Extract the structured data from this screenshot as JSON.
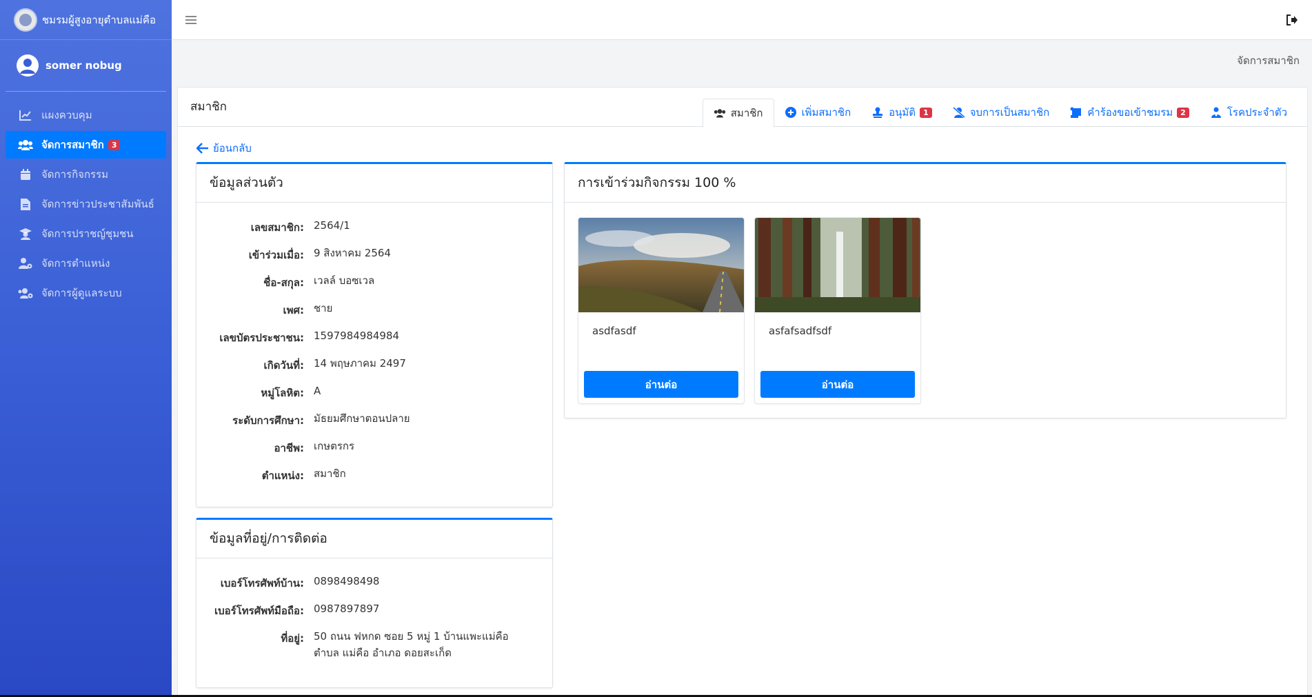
{
  "brand": {
    "title": "ชมรมผู้สูงอายุตำบลแม่คือ"
  },
  "user": {
    "name": "somer nobug"
  },
  "sidebar": {
    "items": [
      {
        "label": "แผงควบคุม",
        "icon": "chart-line-icon"
      },
      {
        "label": "จัดการสมาชิก",
        "icon": "users-icon",
        "badge": "3",
        "active": true
      },
      {
        "label": "จัดการกิจกรรม",
        "icon": "calendar-icon"
      },
      {
        "label": "จัดการข่าวประชาสัมพันธ์",
        "icon": "file-icon"
      },
      {
        "label": "จัดการปราชญ์ชุมชน",
        "icon": "graduate-icon"
      },
      {
        "label": "จัดการตำแหน่ง",
        "icon": "user-cog-icon"
      },
      {
        "label": "จัดการผู้ดูแลระบบ",
        "icon": "users-cog-icon"
      }
    ]
  },
  "breadcrumb": "จัดการสมาชิก",
  "main": {
    "title": "สมาชิก",
    "tabs": [
      {
        "label": "สมาชิก",
        "active": true
      },
      {
        "label": "เพิ่มสมาชิก"
      },
      {
        "label": "อนุมัติ",
        "badge": "1"
      },
      {
        "label": "จบการเป็นสมาชิก"
      },
      {
        "label": "คำร้องขอเข้าชมรม",
        "badge": "2"
      },
      {
        "label": "โรคประจำตัว"
      }
    ],
    "back_label": "ย้อนกลับ"
  },
  "personal": {
    "title": "ข้อมูลส่วนตัว",
    "rows": [
      {
        "label": "เลขสมาชิก:",
        "value": "2564/1"
      },
      {
        "label": "เข้าร่วมเมื่อ:",
        "value": "9 สิงหาคม 2564"
      },
      {
        "label": "ชื่อ-สกุล:",
        "value": "เวลล์ บอซเวล"
      },
      {
        "label": "เพศ:",
        "value": "ชาย"
      },
      {
        "label": "เลขบัตรประชาชน:",
        "value": "1597984984984"
      },
      {
        "label": "เกิดวันที่:",
        "value": "14 พฤษภาคม 2497"
      },
      {
        "label": "หมู่โลหิต:",
        "value": "A"
      },
      {
        "label": "ระดับการศึกษา:",
        "value": "มัธยมศึกษาตอนปลาย"
      },
      {
        "label": "อาชีพ:",
        "value": "เกษตรกร"
      },
      {
        "label": "ตำแหน่ง:",
        "value": "สมาชิก"
      }
    ]
  },
  "contact": {
    "title": "ข้อมูลที่อยู่/การติดต่อ",
    "rows": [
      {
        "label": "เบอร์โทรศัพท์บ้าน:",
        "value": "0898498498"
      },
      {
        "label": "เบอร์โทรศัพท์มือถือ:",
        "value": "0987897897"
      },
      {
        "label": "ที่อยู่:",
        "value": "50 ถนน ฟหกด ซอย 5 หมู่ 1 บ้านแพะแม่คือ",
        "value2": "ตำบล แม่คือ อำเภอ ดอยสะเก็ด"
      }
    ]
  },
  "activities": {
    "title": "การเข้าร่วมกิจกรรม 100 %",
    "items": [
      {
        "name": "asdfasdf",
        "button": "อ่านต่อ"
      },
      {
        "name": "asfafsadfsdf",
        "button": "อ่านต่อ"
      }
    ]
  },
  "colors": {
    "primary": "#007bff",
    "sidebar": "#4e73df",
    "badge": "#dc3545"
  }
}
